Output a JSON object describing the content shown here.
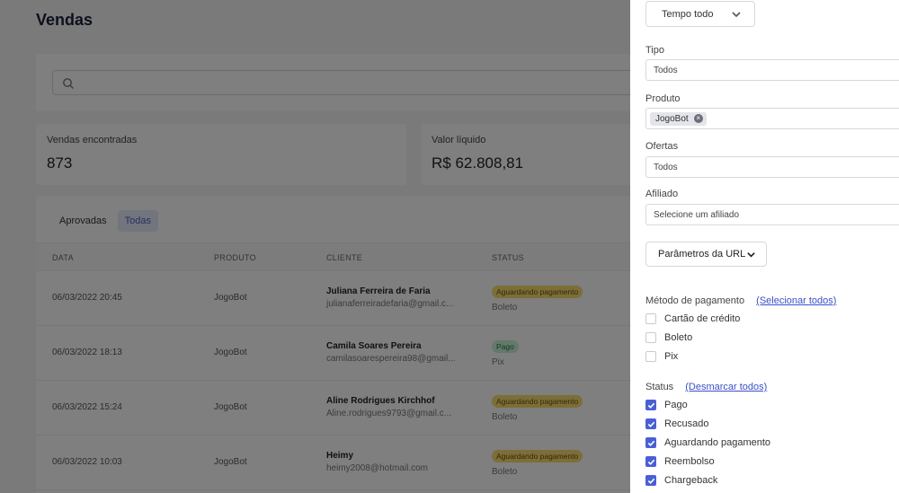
{
  "main": {
    "title": "Vendas",
    "stats": [
      {
        "label": "Vendas encontradas",
        "value": "873"
      },
      {
        "label": "Valor líquido",
        "value": "R$ 62.808,81"
      }
    ],
    "tabs": [
      "Aprovadas",
      "Todas"
    ],
    "columns": [
      "DATA",
      "PRODUTO",
      "CLIENTE",
      "STATUS"
    ],
    "rows": [
      {
        "date": "06/03/2022 20:45",
        "product": "JogoBot",
        "name": "Juliana Ferreira de Faria",
        "email": "julianaferreiradefaria@gmail.c...",
        "status": "Aguardando pagamento",
        "method": "Boleto"
      },
      {
        "date": "06/03/2022 18:13",
        "product": "JogoBot",
        "name": "Camila Soares Pereira",
        "email": "camilasoarespereira98@gmail...",
        "status": "Pago",
        "method": "Pix"
      },
      {
        "date": "06/03/2022 15:24",
        "product": "JogoBot",
        "name": "Aline Rodrigues Kirchhof",
        "email": "Aline.rodrigues9793@gmail.c...",
        "status": "Aguardando pagamento",
        "method": "Boleto"
      },
      {
        "date": "06/03/2022 10:03",
        "product": "JogoBot",
        "name": "Heimy",
        "email": "heimy2008@hotmail.com",
        "status": "Aguardando pagamento",
        "method": "Boleto"
      }
    ]
  },
  "filters": {
    "period": "Tempo todo",
    "tipo_label": "Tipo",
    "tipo_value": "Todos",
    "produto_label": "Produto",
    "produto_chip": "JogoBot",
    "ofertas_label": "Ofertas",
    "ofertas_value": "Todos",
    "afiliado_label": "Afiliado",
    "afiliado_placeholder": "Selecione um afiliado",
    "url_params": "Parâmetros da URL",
    "payment_label": "Método de pagamento",
    "payment_link": "(Selecionar todos)",
    "payment_options": [
      "Cartão de crédito",
      "Boleto",
      "Pix"
    ],
    "status_label": "Status",
    "status_link": "(Desmarcar todos)",
    "status_options": [
      "Pago",
      "Recusado",
      "Aguardando pagamento",
      "Reembolso",
      "Chargeback"
    ],
    "accent_color": "#4a5fd6"
  }
}
